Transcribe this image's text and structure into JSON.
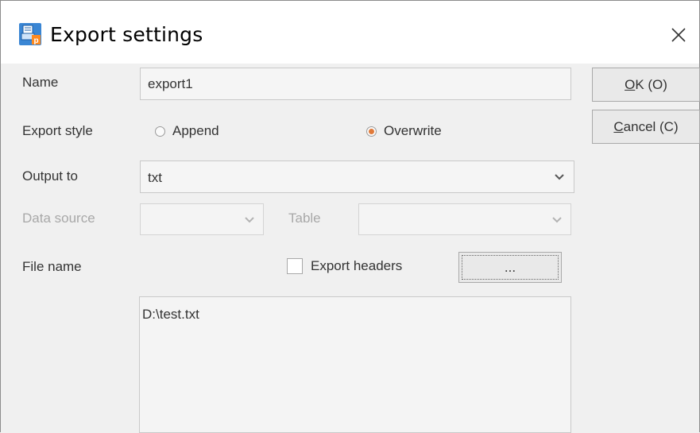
{
  "window": {
    "title": "Export settings",
    "app_icon": "export-app-icon",
    "close_icon": "close-icon"
  },
  "form": {
    "name_label": "Name",
    "name_value": "export1",
    "export_style_label": "Export style",
    "append_label": "Append",
    "overwrite_label": "Overwrite",
    "selected_style": "Overwrite",
    "output_to_label": "Output to",
    "output_to_value": "txt",
    "data_source_label": "Data source",
    "data_source_value": "",
    "table_label": "Table",
    "table_value": "",
    "file_name_label": "File name",
    "export_headers_label": "Export headers",
    "export_headers_checked": false,
    "browse_label": "...",
    "file_name_value": "D:\\test.txt"
  },
  "buttons": {
    "ok_mnemonic": "O",
    "ok_rest": "K (O)",
    "cancel_mnemonic": "C",
    "cancel_rest": "ancel (C)"
  },
  "colors": {
    "accent_radio": "#e07a3a",
    "icon_blue": "#3a86d4"
  }
}
